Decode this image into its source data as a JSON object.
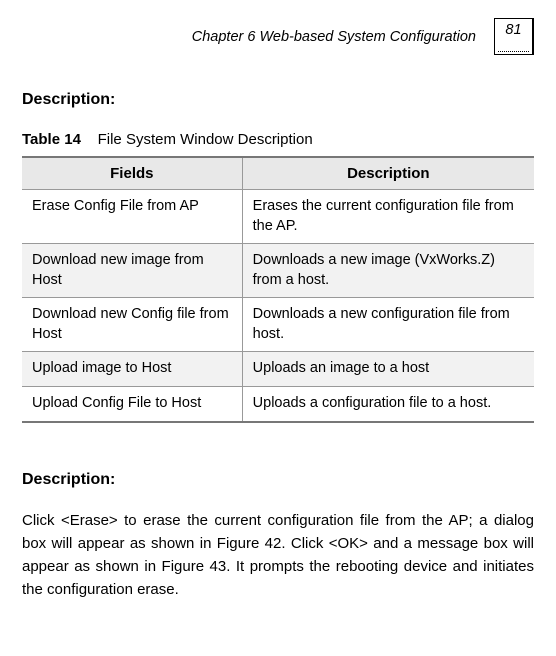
{
  "header": {
    "chapter_title": "Chapter 6 Web-based System Configuration",
    "page_number": "81"
  },
  "sections": {
    "desc1_heading": "Description:",
    "desc2_heading": "Description:",
    "body_paragraph": "Click <Erase> to erase the current configuration file from the AP; a dialog box will appear as shown in Figure 42. Click <OK> and a message box will appear as shown in Figure 43. It prompts the rebooting device and initiates the configuration erase."
  },
  "table": {
    "caption_label": "Table 14",
    "caption_text": "File System Window Description",
    "col1_header": "Fields",
    "col2_header": "Description",
    "rows": [
      {
        "field": "Erase Config File from AP",
        "desc": "Erases the current configuration file from the AP."
      },
      {
        "field": "Download new image from Host",
        "desc": "Downloads a new image (VxWorks.Z) from a host."
      },
      {
        "field": "Download new Config file from Host",
        "desc": "Downloads a new configuration file from host."
      },
      {
        "field": "Upload image to Host",
        "desc": "Uploads an image to a host"
      },
      {
        "field": "Upload Config File to Host",
        "desc": "Uploads a configuration file to a host."
      }
    ]
  }
}
